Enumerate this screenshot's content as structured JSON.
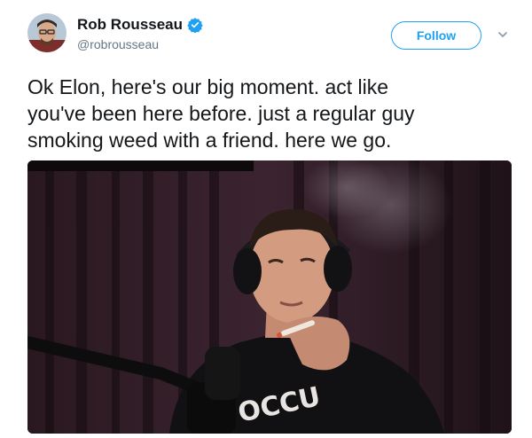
{
  "tweet": {
    "author": {
      "display_name": "Rob Rousseau",
      "handle": "@robrousseau",
      "verified": true,
      "verified_color": "#1da1f2"
    },
    "follow_label": "Follow",
    "text": "Ok Elon, here's our big moment. act like\nyou've been here before. just a regular guy\nsmoking weed with a friend. here we go.",
    "media": {
      "shirt_text": "OCCU"
    }
  },
  "colors": {
    "accent": "#1da1f2",
    "text_primary": "#14171a",
    "text_secondary": "#657786"
  },
  "icons": [
    "verified-badge-icon",
    "chevron-down-icon"
  ]
}
